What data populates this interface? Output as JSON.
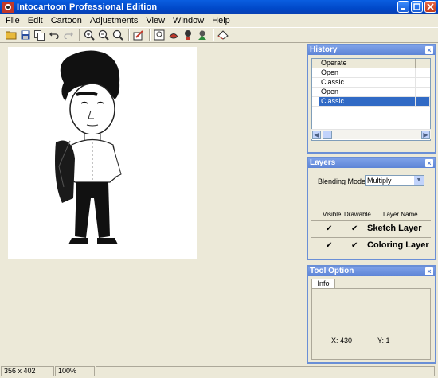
{
  "window": {
    "title": "Intocartoon Professional Edition"
  },
  "menu": [
    "File",
    "Edit",
    "Cartoon",
    "Adjustments",
    "View",
    "Window",
    "Help"
  ],
  "toolbar": {
    "buttons": [
      "open-folder-icon",
      "save-icon",
      "copy-icon",
      "undo-icon",
      "redo-icon",
      "zoom-in-icon",
      "zoom-out-icon",
      "zoom-fit-icon",
      "edit-image-icon",
      "classic-icon",
      "cartoon-icon",
      "caricature-icon",
      "effect-icon",
      "eraser-icon"
    ]
  },
  "history": {
    "title": "History",
    "column": "Operate",
    "rows": [
      "Open",
      "Classic",
      "Open",
      "Classic"
    ],
    "selected_index": 3
  },
  "layers": {
    "title": "Layers",
    "blending_label": "Blending Mode:",
    "blending_value": "Multiply",
    "headers": {
      "visible": "Visible",
      "drawable": "Drawable",
      "name": "Layer Name"
    },
    "rows": [
      {
        "visible": true,
        "drawable": true,
        "name": "Sketch Layer"
      },
      {
        "visible": true,
        "drawable": true,
        "name": "Coloring Layer"
      }
    ]
  },
  "tool_option": {
    "title": "Tool Option",
    "tab": "Info",
    "x": "X: 430",
    "y": "Y: 1"
  },
  "status": {
    "size": "356 x 402",
    "zoom": "100%"
  }
}
